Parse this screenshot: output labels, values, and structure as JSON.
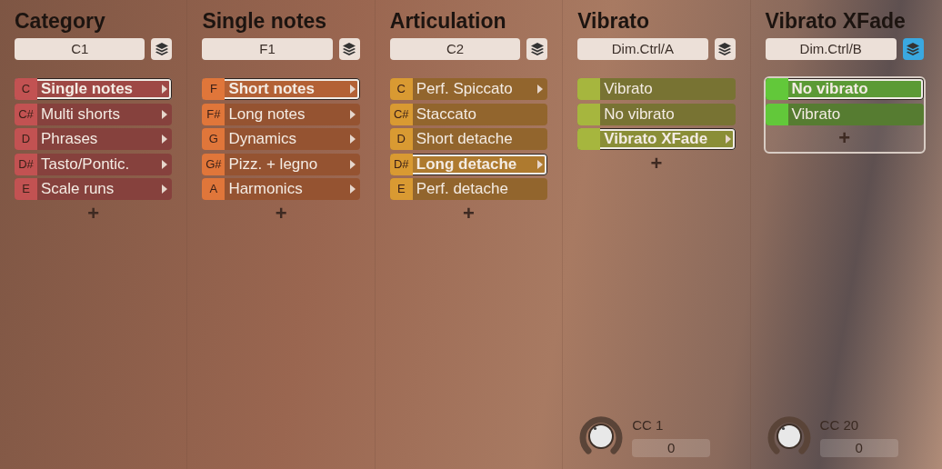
{
  "columns": [
    {
      "title": "Category",
      "trigger": "C1",
      "layers_active": false,
      "color": "#c25252",
      "framed": false,
      "items": [
        {
          "key": "C",
          "label": "Single notes",
          "selected": true,
          "arrow": true
        },
        {
          "key": "C#",
          "label": "Multi shorts",
          "selected": false,
          "arrow": true
        },
        {
          "key": "D",
          "label": "Phrases",
          "selected": false,
          "arrow": true
        },
        {
          "key": "D#",
          "label": "Tasto/Pontic.",
          "selected": false,
          "arrow": true
        },
        {
          "key": "E",
          "label": "Scale runs",
          "selected": false,
          "arrow": true
        }
      ],
      "add": "+"
    },
    {
      "title": "Single notes",
      "trigger": "F1",
      "layers_active": false,
      "color": "#e0763a",
      "framed": false,
      "items": [
        {
          "key": "F",
          "label": "Short notes",
          "selected": true,
          "arrow": true
        },
        {
          "key": "F#",
          "label": "Long notes",
          "selected": false,
          "arrow": true
        },
        {
          "key": "G",
          "label": "Dynamics",
          "selected": false,
          "arrow": true
        },
        {
          "key": "G#",
          "label": "Pizz. + legno",
          "selected": false,
          "arrow": true
        },
        {
          "key": "A",
          "label": "Harmonics",
          "selected": false,
          "arrow": true
        }
      ],
      "add": "+"
    },
    {
      "title": "Articulation",
      "trigger": "C2",
      "layers_active": false,
      "color": "#d99a32",
      "framed": false,
      "items": [
        {
          "key": "C",
          "label": "Perf. Spiccato",
          "selected": false,
          "arrow": true
        },
        {
          "key": "C#",
          "label": "Staccato",
          "selected": false,
          "arrow": false
        },
        {
          "key": "D",
          "label": "Short detache",
          "selected": false,
          "arrow": false
        },
        {
          "key": "D#",
          "label": "Long detache",
          "selected": true,
          "arrow": true
        },
        {
          "key": "E",
          "label": "Perf. detache",
          "selected": false,
          "arrow": false
        }
      ],
      "add": "+"
    },
    {
      "title": "Vibrato",
      "trigger": "Dim.Ctrl/A",
      "layers_active": false,
      "color": "#a6b63e",
      "framed": false,
      "items": [
        {
          "label": "Vibrato",
          "selected": false,
          "arrow": false
        },
        {
          "label": "No vibrato",
          "selected": false,
          "arrow": false
        },
        {
          "label": "Vibrato XFade",
          "selected": true,
          "arrow": true
        }
      ],
      "add": "+",
      "knob": {
        "label": "CC 1",
        "value": "0"
      }
    },
    {
      "title": "Vibrato XFade",
      "trigger": "Dim.Ctrl/B",
      "layers_active": true,
      "color": "#62c83a",
      "framed": true,
      "items": [
        {
          "label": "No vibrato",
          "selected": true,
          "arrow": false
        },
        {
          "label": "Vibrato",
          "selected": false,
          "arrow": false
        }
      ],
      "add": "+",
      "knob": {
        "label": "CC 20",
        "value": "0"
      }
    }
  ]
}
